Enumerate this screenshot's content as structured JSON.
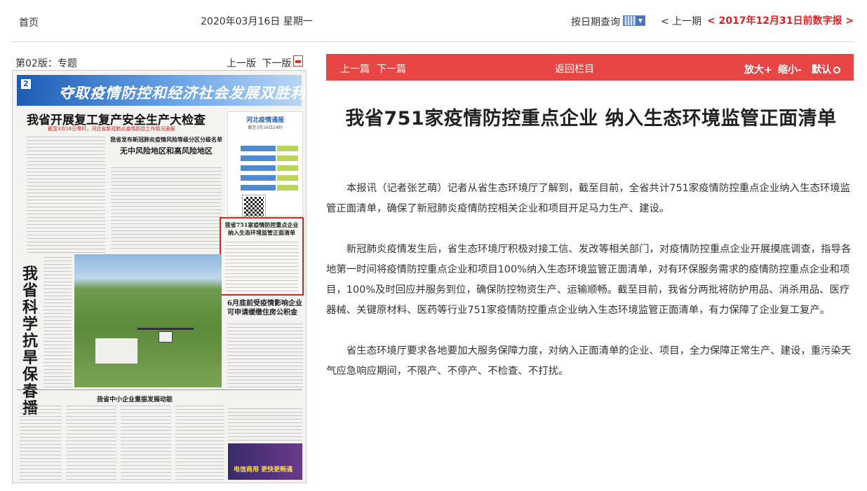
{
  "header": {
    "home": "首页",
    "date": "2020年03月16日  星期一",
    "by_date": "按日期查询",
    "prev_issue": "< 上一期",
    "digital_archive": "< 2017年12月31日前数字报 >"
  },
  "paper": {
    "edition": "第02版：专题",
    "prev_page": "上一版",
    "next_page": "下一版",
    "page_number": "2",
    "banner_title": "夺取疫情防控和经济社会发展双胜利",
    "headline": "我省开展复工复产安全生产大检查",
    "headline_sub": "截至3月16日零时，河北省新冠肺炎疫情防控工作情况通报",
    "box_title_1": "我省发布新冠肺炎疫情风险等级分区分级名单",
    "box_title_2": "无中风险地区和高风险地区",
    "chart_title": "河北疫情通报",
    "chart_sub": "截至3月16日24时",
    "highlight_title_1": "我省751家疫情防控重点企业",
    "highlight_title_2": "纳入生态环境监管正面清单",
    "vertical_title": "我省科学抗旱保春播",
    "side_title_2": "6月底前受疫情影响企业可申请缓缴住房公积金",
    "section_3_title": "我省中小企业重振发展动能",
    "ad_text": "电信商用 更快更畅通"
  },
  "toolbar": {
    "prev_article": "上一篇",
    "next_article": "下一篇",
    "back": "返回栏目",
    "zoom_in": "放大+",
    "zoom_out": "缩小-",
    "default": "默认"
  },
  "article": {
    "title": "我省751家疫情防控重点企业 纳入生态环境监管正面清单",
    "paragraphs": [
      "本报讯（记者张艺萌）记者从省生态环境厅了解到，截至目前，全省共计751家疫情防控重点企业纳入生态环境监管正面清单，确保了新冠肺炎疫情防控相关企业和项目开足马力生产、建设。",
      "新冠肺炎疫情发生后，省生态环境厅积极对接工信、发改等相关部门，对疫情防控重点企业开展摸底调查，指导各地第一时间将疫情防控重点企业和项目100%纳入生态环境监管正面清单，对有环保服务需求的疫情防控重点企业和项目，100%及时回应并服务到位，确保防控物资生产、运输顺畅。截至目前，我省分两批将防护用品、消杀用品、医疗器械、关键原材料、医药等行业751家疫情防控重点企业纳入生态环境监管正面清单，有力保障了企业复工复产。",
      "省生态环境厅要求各地要加大服务保障力度，对纳入正面清单的企业、项目，全力保障正常生产、建设，重污染天气应急响应期间，不限产、不停产、不检查、不打扰。"
    ]
  }
}
